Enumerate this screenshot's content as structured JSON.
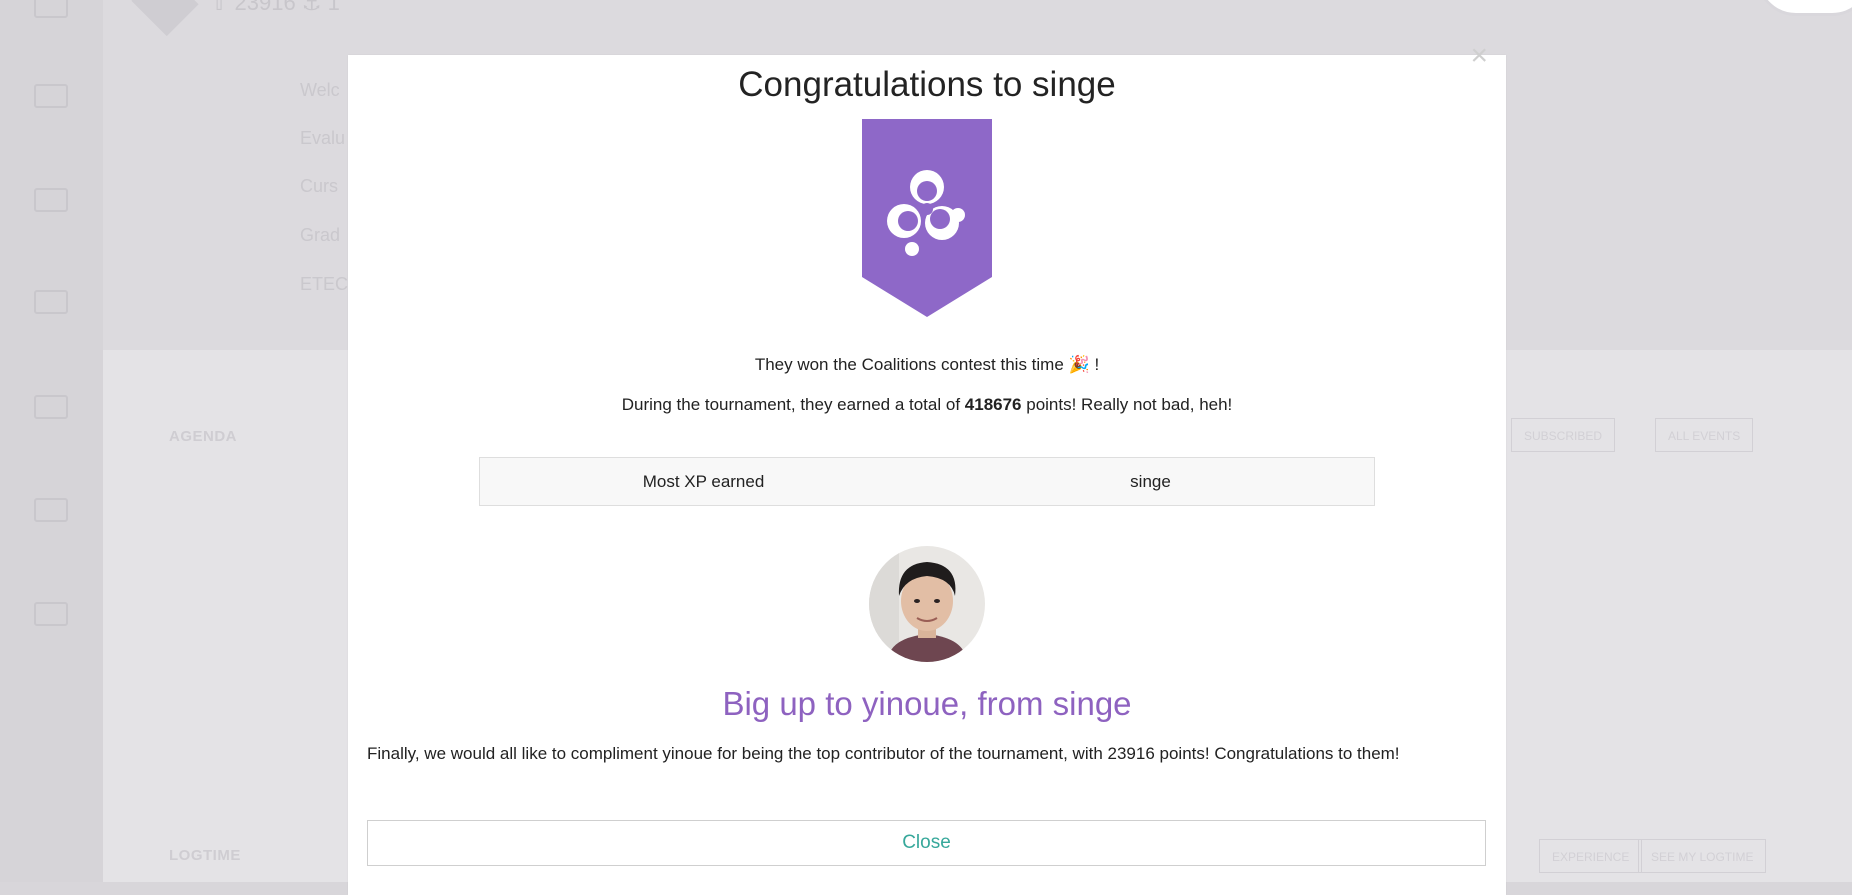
{
  "background": {
    "stats": "⇧ 23916   ⚓ 1",
    "header_links": [
      "Welc",
      "Evalu",
      "Curs",
      "Grad",
      "ETEC"
    ],
    "sections": {
      "agenda_title": "AGENDA",
      "logtime_title": "LOGTIME",
      "agenda_buttons": [
        "SUBSCRIBED",
        "ALL EVENTS"
      ],
      "logtime_buttons": [
        "EXPERIENCE",
        "SEE MY LOGTIME"
      ]
    }
  },
  "modal": {
    "close_icon": "×",
    "title": "Congratulations to singe",
    "banner_color": "#8e68c8",
    "won_text": "They won the Coalitions contest this time",
    "won_emoji": "🎉",
    "won_suffix": "!",
    "points_prefix": "During the tournament, they earned a total of",
    "points_value": "418676",
    "points_suffix": "points! Really not bad, heh!",
    "table": {
      "label": "Most XP earned",
      "value": "singe"
    },
    "bigup_title": "Big up to yinoue, from singe",
    "final_text": "Finally, we would all like to compliment yinoue for being the top contributor of the tournament, with 23916 points! Congratulations to them!",
    "close_button": "Close"
  }
}
